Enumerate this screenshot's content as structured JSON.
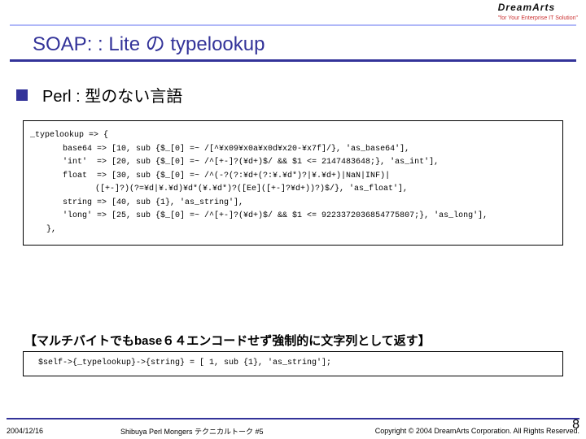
{
  "logo": {
    "main": "DreamArts",
    "sub": "\"for Your Enterprise IT Solution\""
  },
  "slide": {
    "title": "SOAP: : Lite の typelookup",
    "heading": "Perl : 型のない言語"
  },
  "code1": {
    "l0": "_typelookup => {",
    "l1": "base64 => [10, sub {$_[0] =~ /[^¥x09¥x0a¥x0d¥x20-¥x7f]/}, 'as_base64'],",
    "l2": "'int'  => [20, sub {$_[0] =~ /^[+-]?(¥d+)$/ && $1 <= 2147483648;}, 'as_int'],",
    "l3": "float  => [30, sub {$_[0] =~ /^(-?(?:¥d+(?:¥.¥d*)?|¥.¥d+)|NaN|INF)|",
    "l4": "([+-]?)(?=¥d|¥.¥d)¥d*(¥.¥d*)?([Ee]([+-]?¥d+))?)$/}, 'as_float'],",
    "l5": "string => [40, sub {1}, 'as_string'],",
    "l6": "'long' => [25, sub {$_[0] =~ /^[+-]?(¥d+)$/ && $1 <= 9223372036854775807;}, 'as_long'],",
    "l7": "},"
  },
  "note": {
    "title": "【マルチバイトでもbase６４エンコードせず強制的に文字列として返す】"
  },
  "code2": {
    "l0": "$self->{_typelookup}->{string} = [ 1, sub {1}, 'as_string'];"
  },
  "footer": {
    "date": "2004/12/16",
    "center": "Shibuya Perl Mongers テクニカルトーク #5",
    "copy": "Copyright © 2004 DreamArts Corporation. All Rights Reserved.",
    "page": "8"
  }
}
